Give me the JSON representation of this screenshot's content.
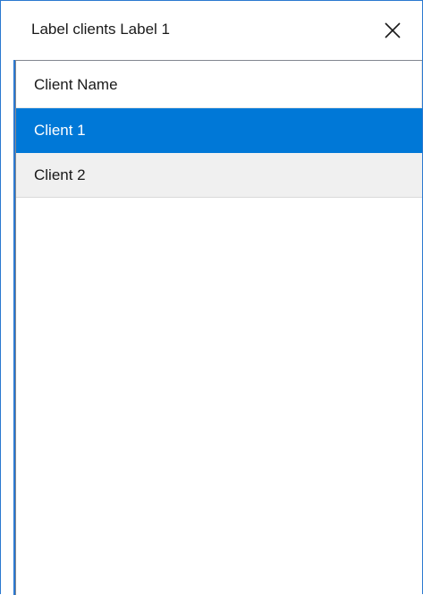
{
  "window": {
    "title": "Label clients Label 1",
    "close_icon": "close-icon"
  },
  "list": {
    "column_header": "Client Name",
    "rows": [
      {
        "label": "Client 1",
        "selected": true
      },
      {
        "label": "Client 2",
        "selected": false
      }
    ]
  },
  "colors": {
    "accent": "#0078d7",
    "border": "#2b79d0",
    "row_alt": "#f0f0f0"
  }
}
